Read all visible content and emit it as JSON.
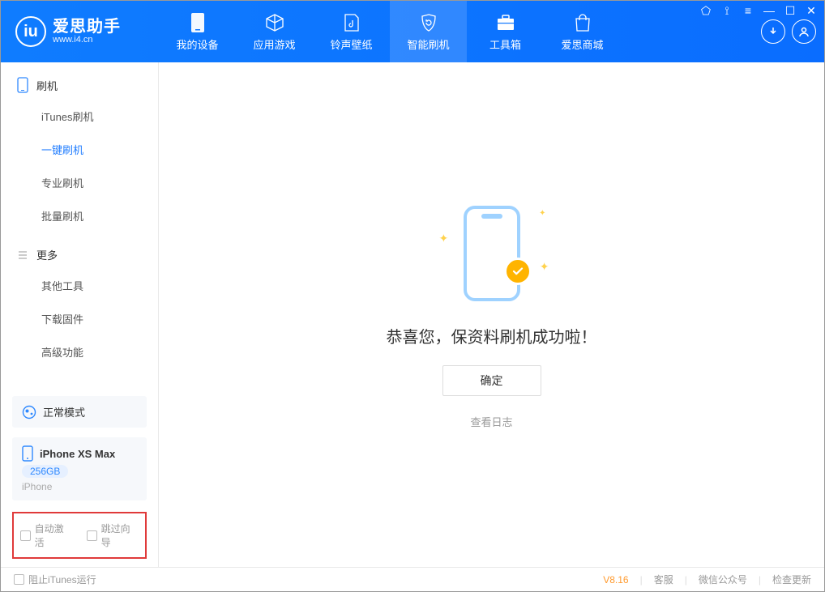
{
  "app": {
    "name": "爱思助手",
    "url": "www.i4.cn"
  },
  "tabs": [
    {
      "label": "我的设备"
    },
    {
      "label": "应用游戏"
    },
    {
      "label": "铃声壁纸"
    },
    {
      "label": "智能刷机"
    },
    {
      "label": "工具箱"
    },
    {
      "label": "爱思商城"
    }
  ],
  "sidebar": {
    "section1_title": "刷机",
    "items1": [
      "iTunes刷机",
      "一键刷机",
      "专业刷机",
      "批量刷机"
    ],
    "section2_title": "更多",
    "items2": [
      "其他工具",
      "下载固件",
      "高级功能"
    ],
    "status_mode": "正常模式",
    "device_name": "iPhone XS Max",
    "device_storage": "256GB",
    "device_type": "iPhone",
    "check_auto_activate": "自动激活",
    "check_skip_guide": "跳过向导"
  },
  "main": {
    "success_msg": "恭喜您，保资料刷机成功啦！",
    "ok_button": "确定",
    "view_log": "查看日志"
  },
  "footer": {
    "block_itunes": "阻止iTunes运行",
    "version": "V8.16",
    "links": [
      "客服",
      "微信公众号",
      "检查更新"
    ]
  }
}
